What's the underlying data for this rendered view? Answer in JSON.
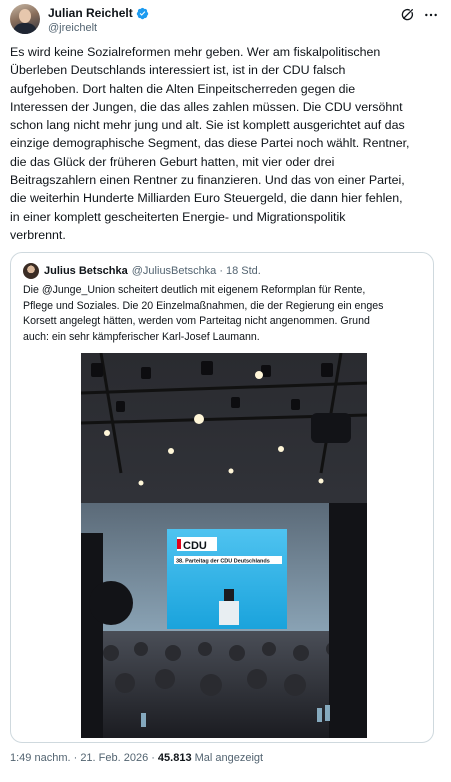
{
  "tweet": {
    "author": {
      "name": "Julian Reichelt",
      "handle": "@jreichelt",
      "verified": true
    },
    "text": "Es wird keine Sozialreformen mehr geben. Wer am fiskalpolitischen\nÜberleben Deutschlands interessiert ist, ist in der CDU falsch\naufgehoben. Dort halten die Alten Einpeitscherreden gegen die\nInteressen der Jungen, die das alles zahlen müssen. Die CDU versöhnt\nschon lang nicht mehr jung und alt. Sie ist komplett ausgerichtet auf das\neinzige demographische Segment, das diese Partei noch wählt. Rentner,\ndie das Glück der früheren Geburt hatten, mit vier oder drei\nBeitragszahlern einen Rentner zu finanzieren. Und das von einer Partei,\ndie weiterhin Hunderte Milliarden Euro Steuergeld, die dann hier fehlen,\nin einer komplett gescheiterten Energie- und Migrationspolitik\nverbrennt.",
    "timestamp": "1:49 nachm. · 21. Feb. 2026 ·",
    "views_count": "45.813",
    "views_label": "Mal angezeigt"
  },
  "quote": {
    "author": {
      "name": "Julius Betschka",
      "handle": "@JuliusBetschka",
      "separator": "·",
      "time": "18 Std."
    },
    "text": "Die @Junge_Union scheitert deutlich mit  eigenem Reformplan für Rente,\nPflege und Soziales. Die 20 Einzelmaßnahmen, die der Regierung ein enges\nKorsett angelegt hätten, werden vom Parteitag nicht angenommen. Grund\nauch: ein sehr kämpferischer Karl-Josef Laumann.",
    "photo": {
      "logo_text": "CDU",
      "banner_text": "38. Parteitag der CDU Deutschlands"
    }
  },
  "colors": {
    "verified": "#1d9bf0",
    "cdu_blue": "#1ab0e6",
    "cdu_red": "#e2001a",
    "muted": "#536471",
    "border": "#cfd9de"
  },
  "icons": [
    "verified-badge-icon",
    "grok-icon",
    "more-icon"
  ]
}
